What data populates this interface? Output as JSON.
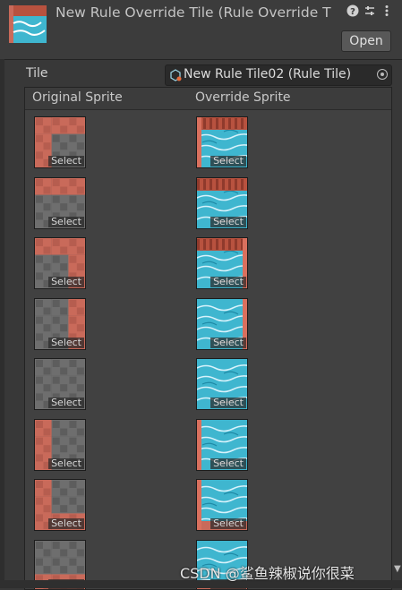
{
  "header": {
    "title": "New Rule Override Tile (Rule Override T",
    "open_label": "Open",
    "icons": [
      "help-icon",
      "preset-icon",
      "kebab-menu-icon"
    ]
  },
  "tile_field": {
    "label": "Tile",
    "value": "New Rule Tile02 (Rule Tile)"
  },
  "table": {
    "original_header": "Original Sprite",
    "override_header": "Override Sprite",
    "select_label": "Select",
    "rows": [
      {
        "original": "corner-top-left-mask",
        "override": "water-top-left-shore"
      },
      {
        "original": "edge-top-mask",
        "override": "water-top-shore"
      },
      {
        "original": "corner-top-right-mask",
        "override": "water-top-right-shore"
      },
      {
        "original": "edge-right-mask",
        "override": "water-right-shore"
      },
      {
        "original": "center-full-mask",
        "override": "water-center"
      },
      {
        "original": "edge-left-mask",
        "override": "water-left-shore"
      },
      {
        "original": "corner-bottom-left-mask",
        "override": "water-bottom-left-shore"
      },
      {
        "original": "edge-bottom-mask",
        "override": "water-bottom-shore"
      }
    ]
  },
  "colors": {
    "panel_bg": "#383838",
    "header_bg": "#3c3c3c",
    "brick_red": "#c96a5a",
    "stone_gray": "#6e6e6e",
    "water_blue": "#3fb6cf"
  },
  "watermark": "CSDN @鲨鱼辣椒说你很菜"
}
